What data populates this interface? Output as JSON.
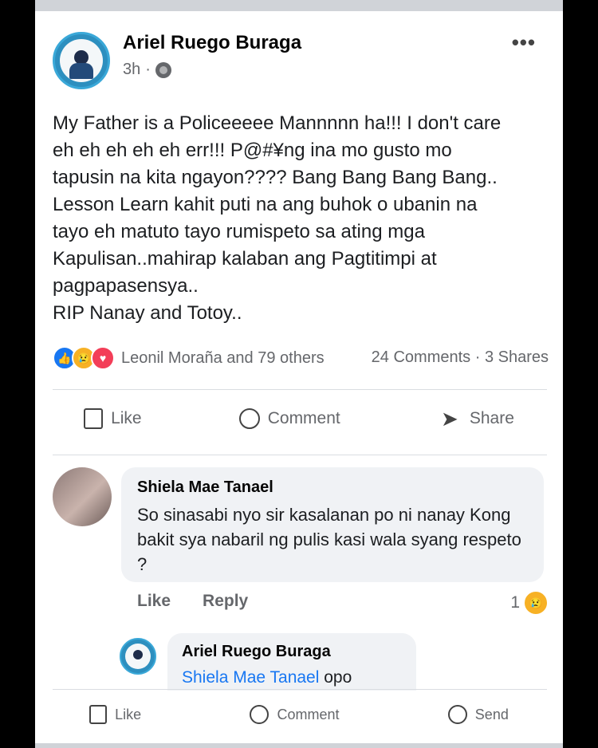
{
  "post": {
    "author": "Ariel Ruego Buraga",
    "time": "3h",
    "separator": "·",
    "more": "•••",
    "text_lines": [
      "My Father is a Policeeeee Mannnnn ha!!! I don't care",
      "eh eh eh eh eh err!!! P@#¥ng ina mo gusto mo",
      "tapusin na kita ngayon???? Bang Bang Bang Bang..",
      "Lesson Learn kahit puti na ang buhok o ubanin na",
      "tayo eh matuto tayo rumispeto sa ating mga",
      "Kapulisan..mahirap kalaban ang Pagtitimpi at",
      "pagpapasensya..",
      "RIP Nanay and Totoy.."
    ],
    "reactions_text": "Leonil Moraña and 79 others",
    "counts": "24 Comments · 3 Shares"
  },
  "actions": {
    "like": "Like",
    "comment": "Comment",
    "share": "Share"
  },
  "comment": {
    "author": "Shiela Mae Tanael",
    "text": "So sinasabi nyo sir kasalanan po ni nanay Kong bakit sya nabaril ng pulis kasi wala syang respeto ?",
    "like": "Like",
    "reply": "Reply",
    "reaction_count": "1"
  },
  "reply": {
    "author": "Ariel Ruego Buraga",
    "mention": "Shiela Mae Tanael",
    "text": "opo"
  },
  "bottom_actions": {
    "like": "Like",
    "comment": "Comment",
    "send": "Send"
  },
  "icons": [
    "globe-icon",
    "more-icon",
    "like-icon",
    "comment-icon",
    "share-icon",
    "send-icon",
    "sad-reaction-icon",
    "love-reaction-icon"
  ],
  "colors": {
    "accent": "#1877f2",
    "text_secondary": "#65676b",
    "bubble": "#f0f2f5"
  }
}
